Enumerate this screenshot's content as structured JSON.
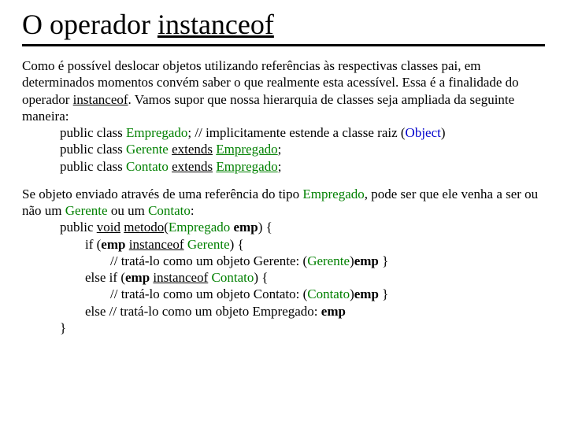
{
  "title": {
    "t1": "O operador ",
    "t2": "instanceof"
  },
  "p1": {
    "a": "Como é possível deslocar objetos utilizando referências às respectivas classes pai, em determinados momentos convém saber o que realmente esta acessível. Essa é a finalidade do operador ",
    "b": "instanceof",
    "c": ". Vamos supor que nossa hierarquia de classes seja ampliada da seguinte maneira:"
  },
  "c1": {
    "a": "public class ",
    "b": "Empregado",
    "c": "; // implicitamente estende a classe raiz (",
    "d": "Object",
    "e": ")"
  },
  "c2": {
    "a": "public class ",
    "b": "Gerente",
    "c": " ",
    "d": "extends",
    "e": " ",
    "f": "Empregado",
    "g": ";"
  },
  "c3": {
    "a": "public class ",
    "b": "Contato",
    "c": " ",
    "d": "extends",
    "e": " ",
    "f": "Empregado",
    "g": ";"
  },
  "p2": {
    "a": "Se objeto enviado através de uma referência do tipo ",
    "b": "Empregado",
    "c": ", pode ser que ele venha a ser ou não um ",
    "d": "Gerente",
    "e": " ou um ",
    "f": "Contato",
    "g": ":"
  },
  "m1": {
    "a": "public ",
    "b": "void",
    "c": " ",
    "d": "metodo",
    "e": "(",
    "f": "Empregado",
    "g": " ",
    "h": "emp",
    "i": ") {"
  },
  "m2": {
    "a": "if (",
    "b": "emp",
    "c": " ",
    "d": "instanceof",
    "e": " ",
    "f": "Gerente",
    "g": ") {"
  },
  "m3": {
    "a": "// tratá-lo como um objeto Gerente: (",
    "b": "Gerente",
    "c": ")",
    "d": "emp",
    "e": " }"
  },
  "m4": {
    "a": "else if (",
    "b": "emp",
    "c": " ",
    "d": "instanceof",
    "e": " ",
    "f": "Contato",
    "g": ") {"
  },
  "m5": {
    "a": "// tratá-lo como um objeto Contato: (",
    "b": "Contato",
    "c": ")",
    "d": "emp",
    "e": " }"
  },
  "m6": {
    "a": "else // tratá-lo como um objeto Empregado: ",
    "b": "emp"
  },
  "m7": "}"
}
